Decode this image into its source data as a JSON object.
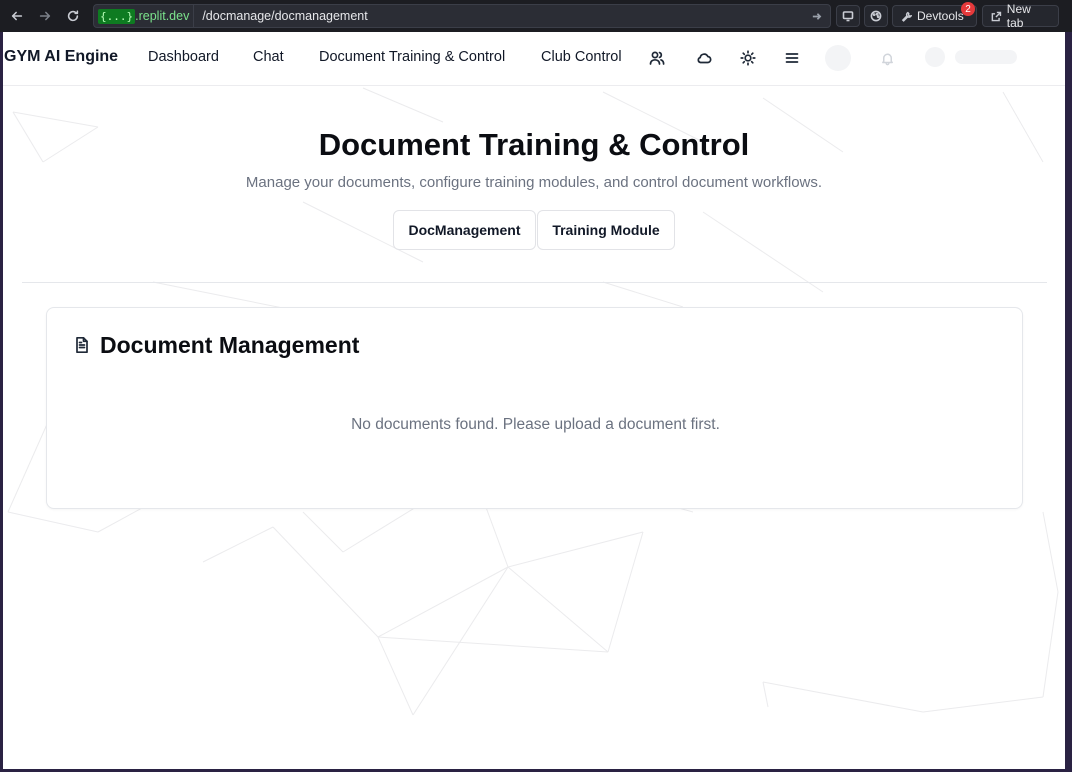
{
  "browser": {
    "url_badge": "{...}",
    "url_domain": ".replit.dev",
    "url_path": "/docmanage/docmanagement",
    "devtools_label": "Devtools",
    "devtools_badge": "2",
    "new_tab_label": "New tab"
  },
  "header": {
    "brand": "GYM AI Engine",
    "nav": [
      "Dashboard",
      "Chat",
      "Document Training & Control",
      "Club Control"
    ],
    "icons": [
      "users-icon",
      "cloud-icon",
      "sun-icon",
      "menu-icon"
    ]
  },
  "hero": {
    "title": "Document Training & Control",
    "subtitle": "Manage your documents, configure training modules, and control document workflows.",
    "tabs": [
      "DocManagement",
      "Training Module"
    ]
  },
  "card": {
    "title": "Document Management",
    "empty_message": "No documents found. Please upload a document first."
  },
  "colors": {
    "accent_text": "#111827",
    "muted_text": "#6b7280",
    "chrome_bg": "#1c1d22",
    "url_badge_bg": "#0e7b21"
  }
}
